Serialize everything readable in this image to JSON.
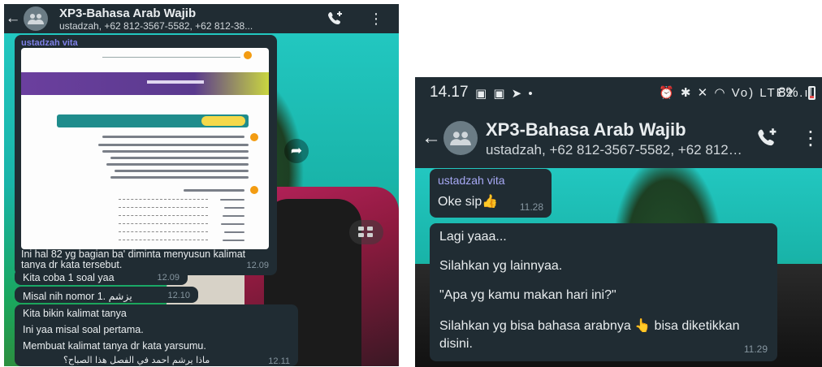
{
  "left": {
    "header": {
      "title": "XP3-Bahasa Arab Wajib",
      "subtitle": "ustadzah, +62 812-3567-5582, +62 812-38..."
    },
    "image_message": {
      "sender": "ustadzah vita",
      "caption": "Ini hal 82 yg bagian ba' diminta menyusun kalimat tanya dr kata tersebut.",
      "time": "12.09"
    },
    "messages": [
      {
        "text": "Kita coba 1 soal yaa",
        "time": "12.09"
      },
      {
        "text": "Misal nih nomor 1. يزشم",
        "time": "12.10"
      }
    ],
    "multi_message": {
      "lines": [
        "Kita bikin kalimat tanya",
        "Ini yaa misal soal pertama.",
        "Membuat kalimat tanya dr kata yarsumu.",
        "ماذا يرشم احمد في الفصل هذا الصباح؟"
      ],
      "time": "12.11"
    }
  },
  "right": {
    "status_bar": {
      "time": "14.17",
      "notifications": "▣ ▣ ➤ •",
      "system_icons": "⏰ ✱ ✕ ◠ Vo) LTE2 .ıl",
      "battery": "8%"
    },
    "header": {
      "title": "XP3-Bahasa Arab Wajib",
      "subtitle": "ustadzah, +62 812-3567-5582, +62 812-38..."
    },
    "message1": {
      "sender": "ustadzah vita",
      "text": "Oke sip",
      "emoji": "👍",
      "time": "11.28"
    },
    "message2": {
      "lines": [
        "Lagi yaaa...",
        "Silahkan yg lainnyaa.",
        "\"Apa yg kamu makan hari ini?\"",
        "Silahkan yg bisa bahasa arabnya",
        "bisa diketikkan",
        "disini."
      ],
      "emoji": "👆",
      "time": "11.29"
    }
  },
  "icons": {
    "back": "←",
    "menu": "⋮",
    "forward": "➦",
    "call": "call-add-icon"
  },
  "colors": {
    "bar": "#202c33",
    "bubble": "#202c33",
    "text": "#e9edef",
    "sender": "#7e80e6",
    "time": "#8696a0"
  }
}
